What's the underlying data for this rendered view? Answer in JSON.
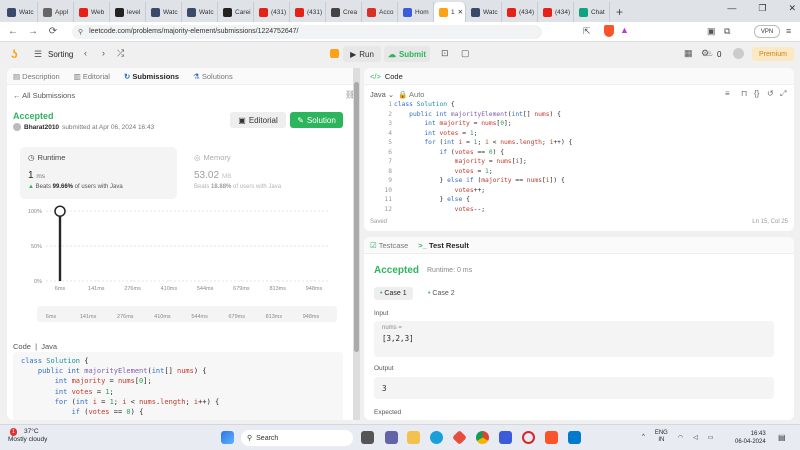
{
  "browser": {
    "tabs": [
      {
        "label": "Watc",
        "icon": "nt-icon",
        "color": "#3b4a6b"
      },
      {
        "label": "Appl",
        "icon": "dash-icon",
        "color": "#666666"
      },
      {
        "label": "Web",
        "icon": "youtube-icon",
        "color": "#e62117"
      },
      {
        "label": "level",
        "icon": "github-icon",
        "color": "#222222"
      },
      {
        "label": "Watc",
        "icon": "nt-icon",
        "color": "#3b4a6b"
      },
      {
        "label": "Watc",
        "icon": "nt-icon",
        "color": "#3b4a6b"
      },
      {
        "label": "Carei",
        "icon": "c-icon",
        "color": "#222222"
      },
      {
        "label": "(431)",
        "icon": "youtube-icon",
        "color": "#e62117"
      },
      {
        "label": "(431)",
        "icon": "youtube-icon",
        "color": "#e62117"
      },
      {
        "label": "Crea",
        "icon": "doc-icon",
        "color": "#444444"
      },
      {
        "label": "Acco",
        "icon": "gmail-icon",
        "color": "#d93025"
      },
      {
        "label": "Hom",
        "icon": "doc-icon",
        "color": "#3b5bdb"
      },
      {
        "label": "1",
        "icon": "leetcode-icon",
        "color": "#ffa116",
        "active": true
      },
      {
        "label": "Watc",
        "icon": "nt-icon",
        "color": "#3b4a6b"
      },
      {
        "label": "(434)",
        "icon": "youtube-icon",
        "color": "#e62117"
      },
      {
        "label": "(434)",
        "icon": "youtube-icon",
        "color": "#e62117"
      },
      {
        "label": "Chat",
        "icon": "chatgpt-icon",
        "color": "#10a37f"
      }
    ],
    "url": "leetcode.com/problems/majority-element/submissions/1224752647/",
    "vpn_label": "VPN"
  },
  "toolbar": {
    "problem_list": "Sorting",
    "run": "Run",
    "submit": "Submit",
    "streak": "0",
    "premium": "Premium"
  },
  "left": {
    "tabs": [
      "Description",
      "Editorial",
      "Submissions",
      "Solutions"
    ],
    "back": "All Submissions",
    "status": "Accepted",
    "user": "Bharat2010",
    "submitted": "submitted at Apr 06, 2024 16:43",
    "editorial_btn": "Editorial",
    "solution_btn": "Solution",
    "runtime": {
      "label": "Runtime",
      "value": "1",
      "unit": "ms",
      "beats_pre": "Beats",
      "beats": "99.66%",
      "beats_post": "of users with Java"
    },
    "memory": {
      "label": "Memory",
      "value": "53.02",
      "unit": "MB",
      "beats_pre": "Beats",
      "beats": "18.88%",
      "beats_post": "of users with Java"
    },
    "code_label": "Code",
    "code_lang": "Java",
    "code": [
      "class Solution {",
      "    public int majorityElement(int[] nums) {",
      "        int majority = nums[0];",
      "        int votes = 1;",
      "        for (int i = 1; i < nums.length; i++) {",
      "            if (votes == 0) {"
    ]
  },
  "chart_data": {
    "type": "bar",
    "title": "",
    "xlabel": "",
    "ylabel": "",
    "yticks": [
      "100%",
      "50%",
      "0%"
    ],
    "categories": [
      "6ms",
      "141ms",
      "276ms",
      "410ms",
      "544ms",
      "679ms",
      "813ms",
      "948ms"
    ],
    "values": [
      99.66,
      0,
      0,
      0,
      0,
      0,
      0,
      0
    ],
    "ylim": [
      0,
      100
    ],
    "highlight": "1ms"
  },
  "editor": {
    "title": "Code",
    "lang": "Java",
    "mode": "Auto",
    "saved": "Saved",
    "cursor": "Ln 15, Col 25",
    "line_numbers": [
      "1",
      "2",
      "3",
      "4",
      "5",
      "6",
      "7",
      "8",
      "9",
      "10",
      "11",
      "12"
    ],
    "lines": [
      "class Solution {",
      "    public int majorityElement(int[] nums) {",
      "        int majority = nums[0];",
      "        int votes = 1;",
      "        for (int i = 1; i < nums.length; i++) {",
      "            if (votes == 0) {",
      "                majority = nums[i];",
      "                votes = 1;",
      "            } else if (majority == nums[i]) {",
      "                votes++;",
      "            } else {",
      "                votes--;"
    ]
  },
  "result": {
    "tab_testcase": "Testcase",
    "tab_result": "Test Result",
    "status": "Accepted",
    "runtime": "Runtime: 0 ms",
    "cases": [
      "Case 1",
      "Case 2"
    ],
    "input_label": "Input",
    "input_var": "nums =",
    "input_value": "[3,2,3]",
    "output_label": "Output",
    "output_value": "3",
    "expected_label": "Expected"
  },
  "taskbar": {
    "temp": "37°C",
    "weather": "Mostly cloudy",
    "badge": "1",
    "search": "Search",
    "lang": "ENG",
    "region": "IN",
    "time": "16:43",
    "date": "06-04-2024"
  }
}
